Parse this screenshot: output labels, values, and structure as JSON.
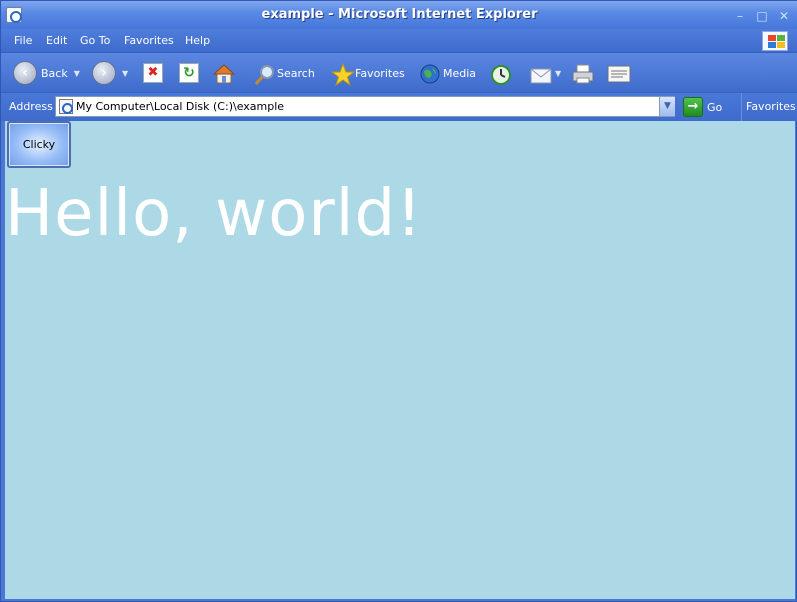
{
  "window": {
    "title": "example - Microsoft Internet Explorer",
    "controls": {
      "minimize": "–",
      "maximize": "□",
      "close": "✕"
    }
  },
  "menu": {
    "items": [
      "File",
      "Edit",
      "Go To",
      "Favorites",
      "Help"
    ]
  },
  "toolbar": {
    "back_label": "Back",
    "search_label": "Search",
    "favorites_label": "Favorites",
    "media_label": "Media"
  },
  "address": {
    "label": "Address",
    "value": "My Computer\\Local Disk (C:)\\example",
    "go_label": "Go",
    "favorites_label": "Favorites"
  },
  "page": {
    "button_label": "Clicky",
    "heading": "Hello, world!",
    "background_color": "#add8e6",
    "text_color": "#ffffff"
  },
  "colors": {
    "chrome_blue": "#4b78d6",
    "title_text": "#ffffff"
  }
}
